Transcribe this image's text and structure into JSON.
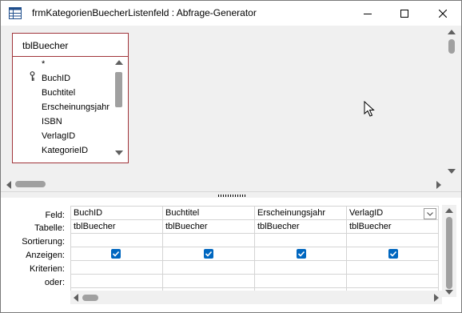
{
  "window": {
    "title": "frmKategorienBuecherListenfeld : Abfrage-Generator",
    "controls": [
      "minimize-icon",
      "maximize-icon",
      "close-icon"
    ]
  },
  "table_card": {
    "title": "tblBuecher",
    "fields": [
      "*",
      "BuchID",
      "Buchtitel",
      "Erscheinungsjahr",
      "ISBN",
      "VerlagID",
      "KategorieID"
    ],
    "primary_key": "BuchID"
  },
  "qbe": {
    "row_labels": [
      "Feld:",
      "Tabelle:",
      "Sortierung:",
      "Anzeigen:",
      "Kriterien:",
      "oder:"
    ],
    "columns": [
      {
        "field": "BuchID",
        "table": "tblBuecher",
        "show": true
      },
      {
        "field": "Buchtitel",
        "table": "tblBuecher",
        "show": true
      },
      {
        "field": "Erscheinungsjahr",
        "table": "tblBuecher",
        "show": true
      },
      {
        "field": "VerlagID",
        "table": "tblBuecher",
        "show": true,
        "has_dropdown": true
      }
    ]
  },
  "colors": {
    "table_border": "#a1343a",
    "checkbox": "#0067c0",
    "scroll_thumb": "#a0a0a0"
  }
}
